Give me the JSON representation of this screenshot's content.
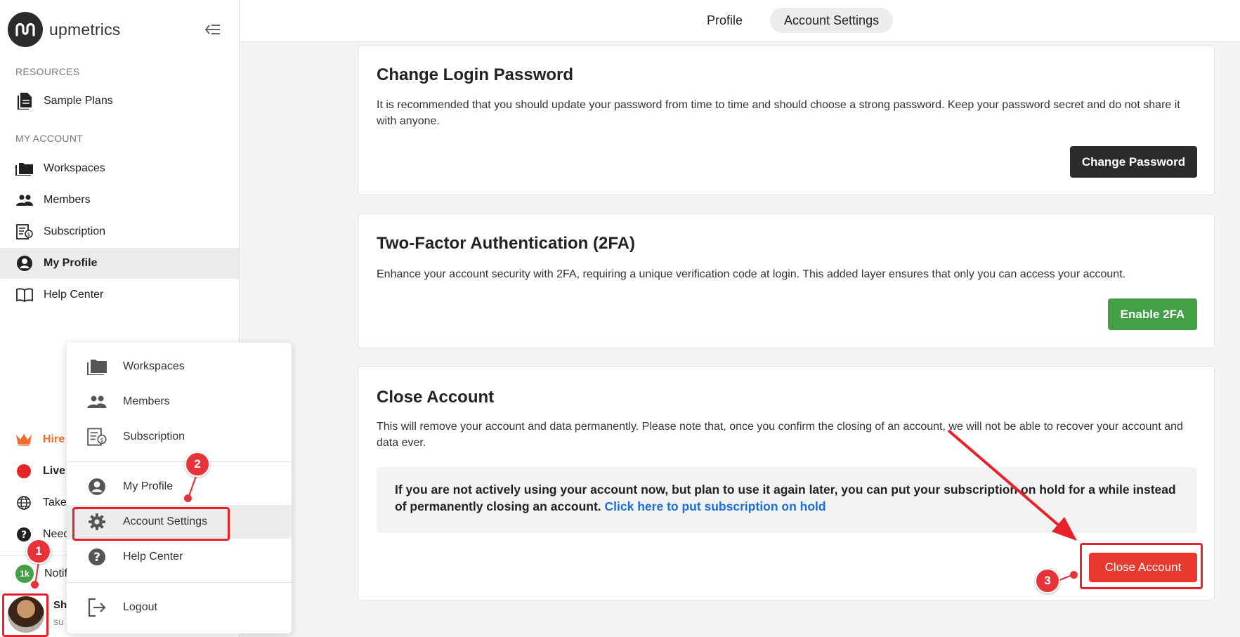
{
  "brand": {
    "name": "upmetrics"
  },
  "sidebar": {
    "resources_label": "RESOURCES",
    "my_account_label": "MY ACCOUNT",
    "resources": [
      {
        "label": "Sample Plans",
        "icon": "document-icon"
      }
    ],
    "account": [
      {
        "label": "Workspaces",
        "icon": "folder-icon"
      },
      {
        "label": "Members",
        "icon": "people-icon"
      },
      {
        "label": "Subscription",
        "icon": "subscription-icon"
      },
      {
        "label": "My Profile",
        "icon": "person-circle-icon",
        "active": true
      },
      {
        "label": "Help Center",
        "icon": "book-icon"
      }
    ],
    "extras": [
      {
        "label": "Hire",
        "icon": "crown-icon",
        "color": "#ef6c2f"
      },
      {
        "label": "Live",
        "icon": "record-icon",
        "color": "#e8222a"
      },
      {
        "label": "Take",
        "icon": "globe-icon"
      },
      {
        "label": "Need",
        "icon": "question-icon"
      },
      {
        "label": "Notifi",
        "icon": "notification-badge-icon",
        "badge": "1k"
      }
    ],
    "user": {
      "name": "Sh",
      "sub": "su"
    }
  },
  "tabs": [
    {
      "label": "Profile",
      "active": false
    },
    {
      "label": "Account Settings",
      "active": true
    }
  ],
  "password_card": {
    "title": "Change Login Password",
    "text": "It is recommended that you should update your password from time to time and should choose a strong password. Keep your password secret and do not share it with anyone.",
    "button": "Change Password"
  },
  "twofa_card": {
    "title": "Two-Factor Authentication (2FA)",
    "text": "Enhance your account security with 2FA, requiring a unique verification code at login. This added layer ensures that only you can access your account.",
    "button": "Enable 2FA"
  },
  "close_card": {
    "title": "Close Account",
    "text": "This will remove your account and data permanently. Please note that, once you confirm the closing of an account, we will not be able to recover your account and data ever.",
    "info": "If you are not actively using your account now, but plan to use it again later, you can put your subscription on hold for a while instead of permanently closing an account.",
    "info_link": "Click here to put subscription on hold",
    "button": "Close Account"
  },
  "menu": {
    "items": [
      {
        "label": "Workspaces",
        "icon": "folder-icon"
      },
      {
        "label": "Members",
        "icon": "people-icon"
      },
      {
        "label": "Subscription",
        "icon": "subscription-icon"
      },
      {
        "label": "My Profile",
        "icon": "person-circle-icon"
      },
      {
        "label": "Account Settings",
        "icon": "gear-icon",
        "highlighted": true
      },
      {
        "label": "Help Center",
        "icon": "question-icon"
      },
      {
        "label": "Logout",
        "icon": "logout-icon"
      }
    ]
  },
  "annotations": {
    "step1": "1",
    "step2": "2",
    "step3": "3"
  },
  "colors": {
    "dark_button": "#2b2b2b",
    "green_button": "#43a047",
    "red_button": "#e8392f",
    "annotation_red": "#e8222a",
    "link": "#1a6fd6"
  }
}
